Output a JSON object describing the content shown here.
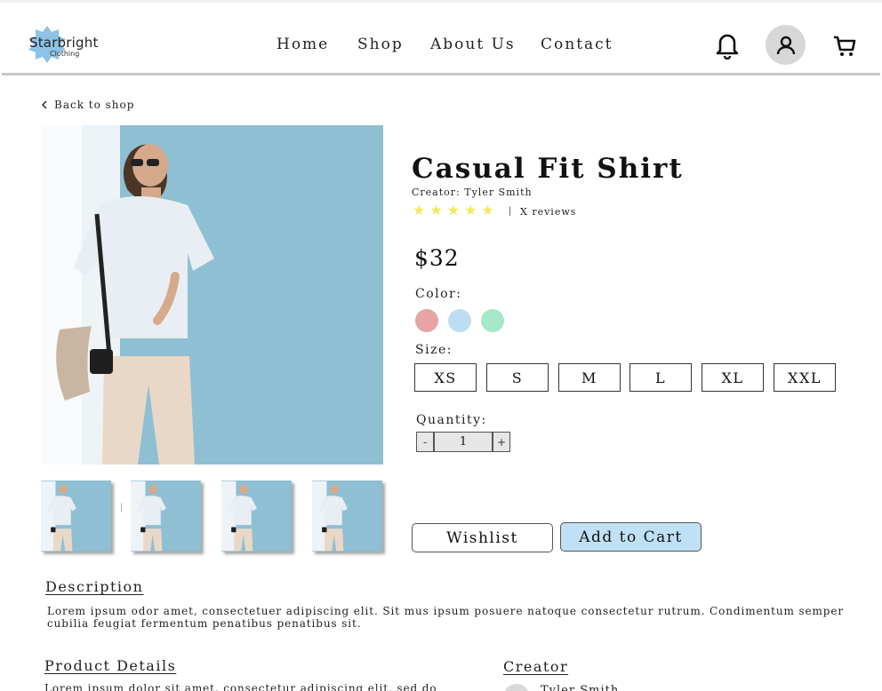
{
  "brand": {
    "name": "Starbright",
    "subtitle": "Clothing",
    "logo_color": "#8cc3e6"
  },
  "nav": [
    "Home",
    "Shop",
    "About Us",
    "Contact"
  ],
  "header_icons": [
    "bell-icon",
    "user-icon",
    "cart-icon"
  ],
  "back_link": "Back to shop",
  "product": {
    "title": "Casual Fit Shirt",
    "creator": "Creator: Tyler Smith",
    "rating_stars": 5,
    "rating_separator": "|",
    "reviews": "X reviews",
    "price": "$32",
    "color_label": "Color:",
    "colors": [
      "#e8a3a3",
      "#bedcf2",
      "#a5e7c6"
    ],
    "size_label": "Size:",
    "sizes": [
      "XS",
      "S",
      "M",
      "L",
      "XL",
      "XXL"
    ],
    "quantity_label": "Quantity:",
    "quantity_value": "1",
    "qty_minus": "-",
    "qty_plus": "+",
    "wishlist_label": "Wishlist",
    "add_to_cart_label": "Add to Cart"
  },
  "thumbnails_count": 4,
  "thumb_divider": "|",
  "description": {
    "heading": "Description",
    "text": "Lorem ipsum odor amet, consectetuer adipiscing elit. Sit mus ipsum posuere natoque consectetur rutrum. Condimentum semper cubilia feugiat fermentum penatibus penatibus sit."
  },
  "product_details": {
    "heading": "Product Details",
    "text": "Lorem ipsum dolor sit amet, consectetur adipiscing elit, sed do"
  },
  "creator_section": {
    "heading": "Creator",
    "name": "Tyler Smith"
  },
  "colors": {
    "accent": "#bfe0f5",
    "star": "#f2e85c",
    "photo_bg": "#8fbfd3"
  }
}
